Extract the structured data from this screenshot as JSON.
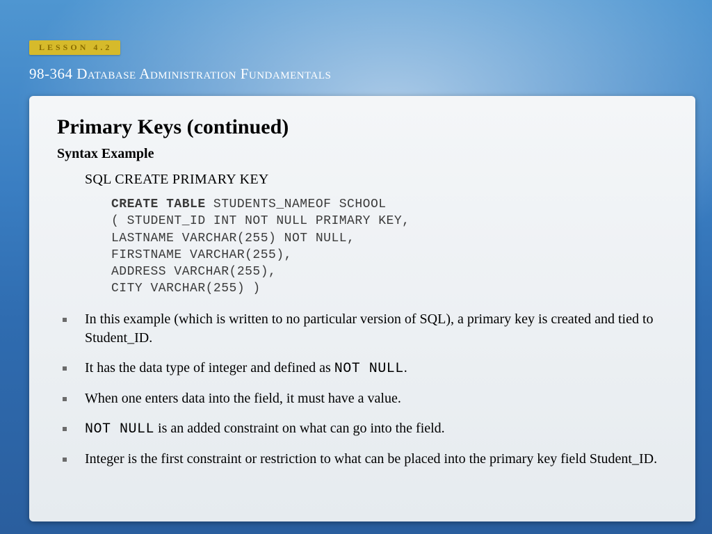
{
  "header": {
    "lesson_label": "LESSON 4.2",
    "course_title": "98-364 Database Administration Fundamentals"
  },
  "slide": {
    "title": "Primary Keys (continued)",
    "subhead": "Syntax  Example",
    "sql_heading": "SQL CREATE PRIMARY KEY",
    "code": {
      "kw": "CREATE TABLE",
      "line1_rest": "  STUDENTS_NAMEOF SCHOOL",
      "line2": "( STUDENT_ID  INT  NOT NULL PRIMARY KEY,",
      "line3": "LASTNAME  VARCHAR(255) NOT NULL,",
      "line4": "FIRSTNAME  VARCHAR(255),",
      "line5": "ADDRESS  VARCHAR(255),",
      "line6": "CITY  VARCHAR(255) )"
    },
    "bullets": {
      "b1": "In this example (which is written to no particular version of SQL), a primary key is created and tied to Student_ID.",
      "b2_pre": "It has the data type of integer and defined as ",
      "b2_code": "NOT NULL",
      "b2_post": ".",
      "b3": "When one enters data into the field, it must have a value.",
      "b4_code": "NOT NULL",
      "b4_post": " is an added constraint on what can go into the field.",
      "b5": "Integer is the first constraint or restriction to what can be placed into the primary key field Student_ID."
    }
  }
}
